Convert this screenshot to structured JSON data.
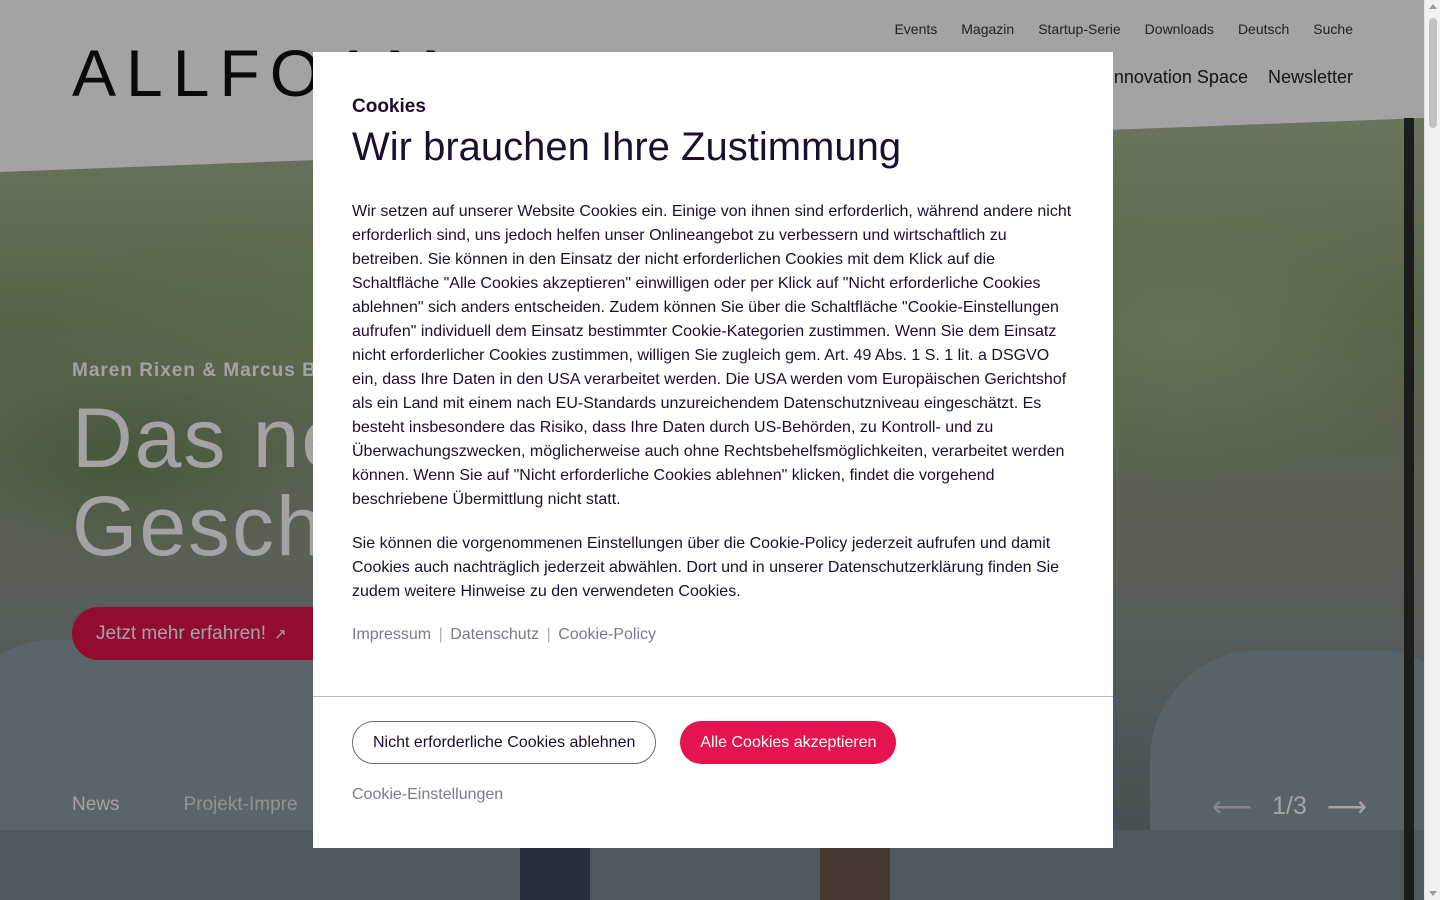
{
  "header": {
    "logo_text": "ALLFOAM",
    "utility_nav": [
      "Events",
      "Magazin",
      "Startup-Serie",
      "Downloads",
      "Deutsch",
      "Suche"
    ],
    "main_nav": [
      "Innovation Space",
      "Newsletter"
    ]
  },
  "hero": {
    "kicker": "Maren Rixen & Marcus Ba",
    "title_line1": "Das ne",
    "title_line2": "Gesch",
    "cta_label": "Jetzt mehr erfahren!",
    "cta_icon": "arrow-up-right-icon",
    "tabs": [
      "News",
      "Projekt-Impre"
    ],
    "slider_counter": "1/3",
    "prev_icon": "arrow-left-icon",
    "next_icon": "arrow-right-icon"
  },
  "cookie_modal": {
    "kicker": "Cookies",
    "title": "Wir brauchen Ihre Zustimmung",
    "paragraph1": "Wir setzen auf unserer Website Cookies ein. Einige von ihnen sind erforderlich, während andere nicht erforderlich sind, uns jedoch helfen unser Onlineangebot zu verbessern und wirtschaftlich zu betreiben. Sie können in den Einsatz der nicht erforderlichen Cookies mit dem Klick auf die Schaltfläche \"Alle Cookies akzeptieren\" einwilligen oder per Klick auf \"Nicht erforderliche Cookies ablehnen\" sich anders entscheiden. Zudem können Sie über die Schaltfläche \"Cookie-Einstellungen aufrufen\" individuell dem Einsatz bestimmter Cookie-Kategorien zustimmen. Wenn Sie dem Einsatz nicht erforderlicher Cookies zustimmen, willigen Sie zugleich gem. Art. 49 Abs. 1 S. 1 lit. a DSGVO ein, dass Ihre Daten in den USA verarbeitet werden. Die USA werden vom Europäischen Gerichtshof als ein Land mit einem nach EU-Standards unzureichendem Datenschutzniveau eingeschätzt. Es besteht insbesondere das Risiko, dass Ihre Daten durch US-Behörden, zu Kontroll- und zu Überwachungszwecken, möglicherweise auch ohne Rechtsbehelfsmöglichkeiten, verarbeitet werden können. Wenn Sie auf \"Nicht erforderliche Cookies ablehnen\" klicken, findet die vorgehend beschriebene Übermittlung nicht statt.",
    "paragraph2": "Sie können die vorgenommenen Einstellungen über die Cookie-Policy jederzeit aufrufen und damit Cookies auch nachträglich jederzeit abwählen. Dort und in unserer Datenschutzerklärung finden Sie zudem weitere Hinweise zu den verwendeten Cookies.",
    "links": [
      "Impressum",
      "Datenschutz",
      "Cookie-Policy"
    ],
    "link_separator": "|",
    "decline_label": "Nicht erforderliche Cookies ablehnen",
    "accept_label": "Alle Cookies akzeptieren",
    "settings_label": "Cookie-Einstellungen"
  },
  "colors": {
    "accent": "#e5134f",
    "text_dark": "#1b0f2e",
    "link_muted": "#7d7890"
  }
}
